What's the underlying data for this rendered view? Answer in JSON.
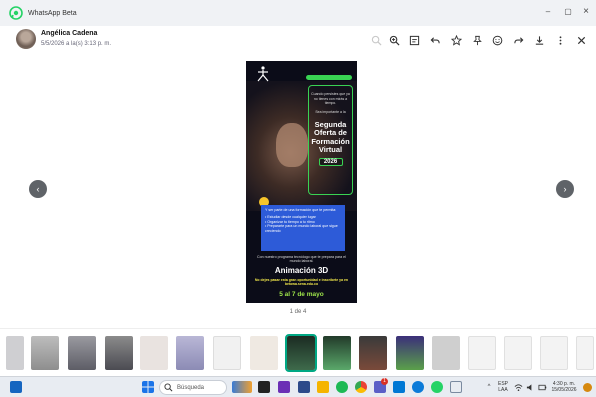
{
  "window": {
    "app_name": "WhatsApp Beta",
    "minimize": "–",
    "maximize": "▢",
    "close": "×"
  },
  "header": {
    "sender": "Angélica Cadena",
    "timestamp": "5/5/2026 a la(s) 3:13 p. m.",
    "icons": [
      "zoom-out-icon",
      "zoom-in-icon",
      "caption-icon",
      "reply-icon",
      "star-icon",
      "pin-icon",
      "emoji-icon",
      "forward-icon",
      "download-icon",
      "more-icon",
      "close-icon"
    ]
  },
  "viewer": {
    "prev": "‹",
    "next": "›",
    "counter": "1 de 4"
  },
  "poster": {
    "bubble_text": "Cuando persistes que ya no tienes con mirás a tiempo.",
    "bubble_text2": "Sea importante a la",
    "headline": "Segunda Oferta de Formación Virtual",
    "year": "2026",
    "info_title": "Y ser parte de una formación que te permita:",
    "bullets": [
      "• Estudiar desde cualquier lugar",
      "• Organizar tu tiempo a tu ritmo",
      "• Prepararte para un mundo laboral que sigue creciendo"
    ],
    "program_intro": "Con nuestro programa tecnólogo que te prepara para el mundo laboral.",
    "program": "Animación 3D",
    "cta": "No dejes pasar esta gran oportunidad e inscríbete ya en betowa.sena.edu.co",
    "dates": "5 al 7 de mayo"
  },
  "taskbar": {
    "search_placeholder": "Búsqueda",
    "lang_top": "ESP",
    "lang_bottom": "LAA",
    "time": "4:30 p. m.",
    "date": "15/05/2026",
    "notification_badge": "1"
  }
}
